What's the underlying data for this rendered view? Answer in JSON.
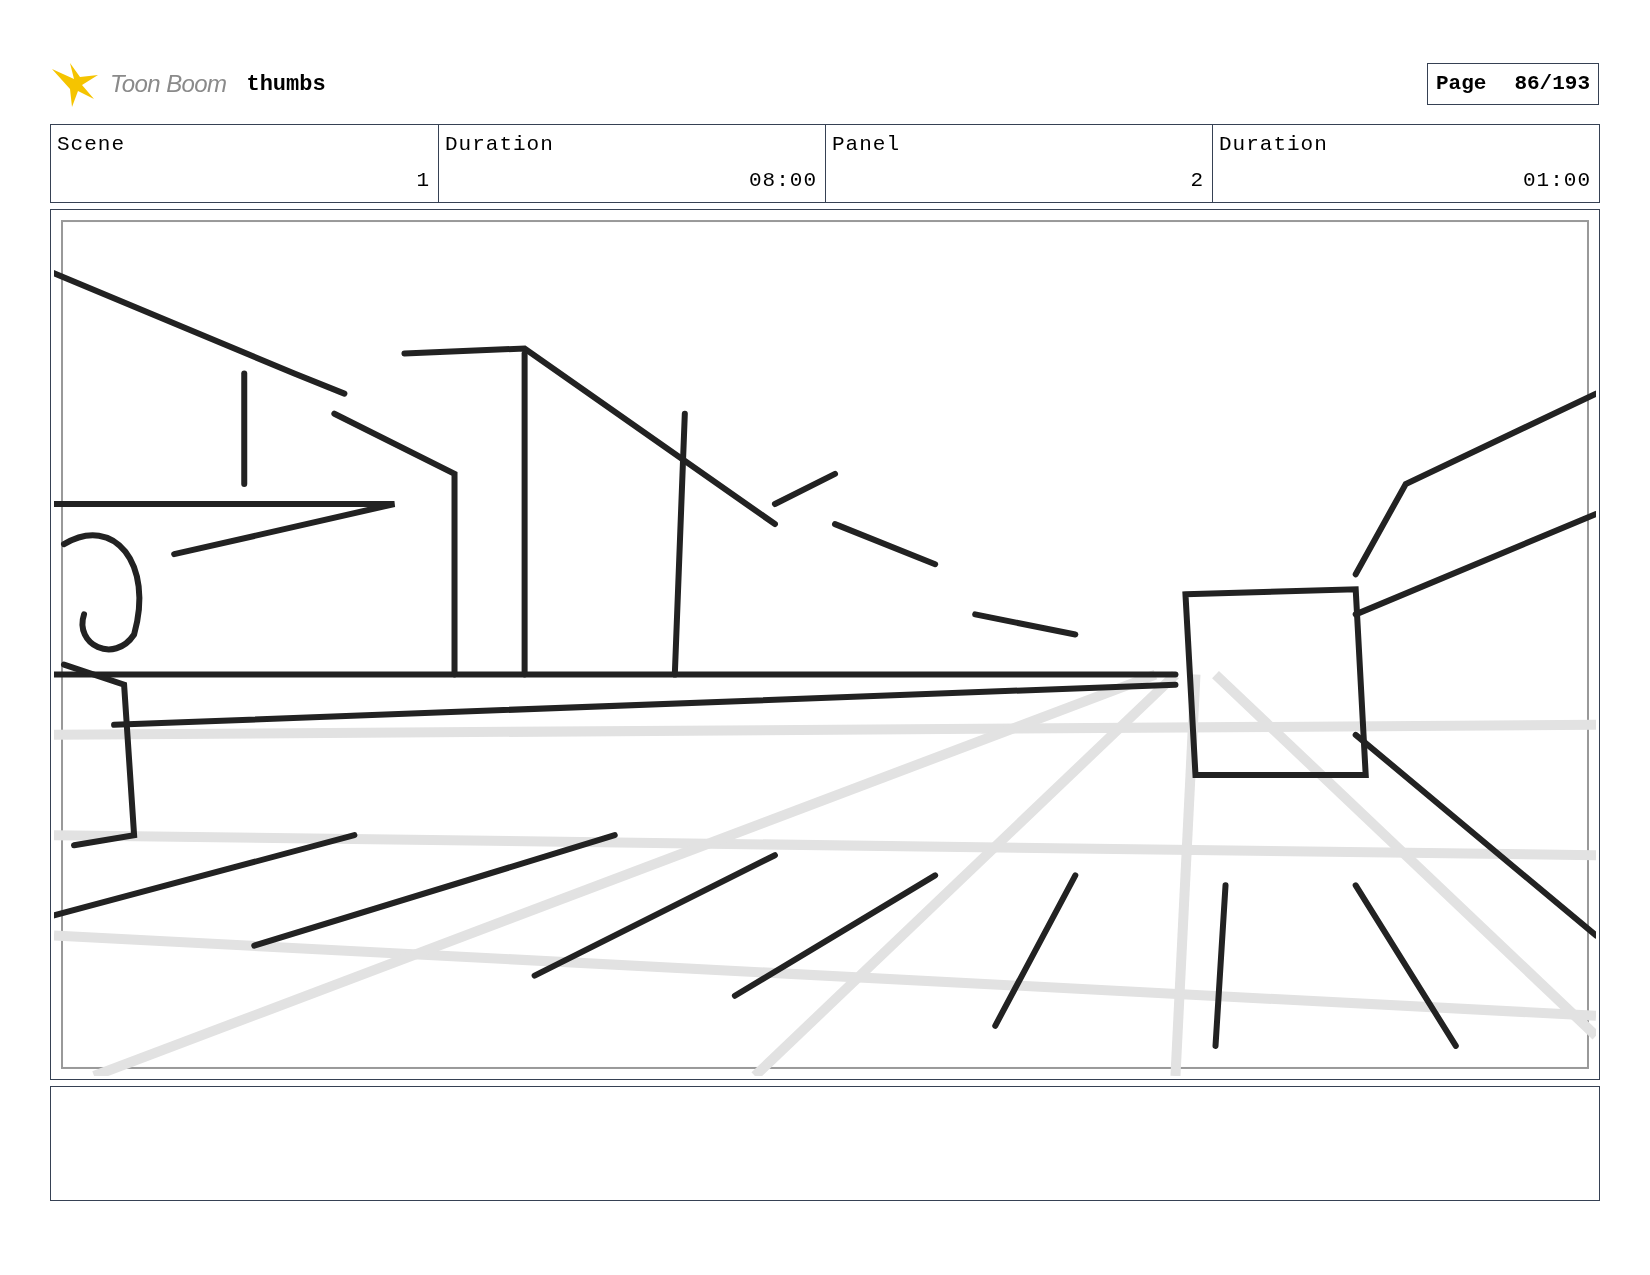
{
  "header": {
    "logo": "Toon Boom",
    "title": "thumbs",
    "page_label": "Page",
    "page": "86/193"
  },
  "info_table": {
    "columns": [
      "Scene",
      "Duration",
      "Panel",
      "Duration"
    ],
    "row": [
      "1",
      "08:00",
      "2",
      "01:00"
    ]
  }
}
